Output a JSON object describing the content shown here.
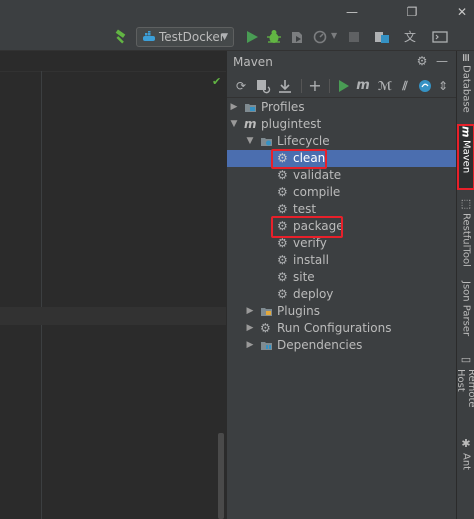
{
  "window": {
    "minimize": "—",
    "restore": "❐",
    "close": "✕"
  },
  "toolbar": {
    "run_config": "TestDocker"
  },
  "maven_panel": {
    "title": "Maven"
  },
  "tree": {
    "profiles": "Profiles",
    "project": "plugintest",
    "lifecycle": "Lifecycle",
    "phases": [
      "clean",
      "validate",
      "compile",
      "test",
      "package",
      "verify",
      "install",
      "site",
      "deploy"
    ],
    "plugins": "Plugins",
    "run_configurations": "Run Configurations",
    "dependencies": "Dependencies",
    "selected": "clean",
    "highlighted": [
      "clean",
      "package"
    ]
  },
  "right_tabs": {
    "database": "Database",
    "maven": "Maven",
    "restful": "RestfulTool",
    "json_parser": "Json Parser",
    "remote_host": "Remote Host",
    "ant": "Ant"
  },
  "colors": {
    "selection": "#4b6eaf",
    "highlight_box": "#e8202a",
    "run_green": "#499c54"
  },
  "icons": {
    "hammer": "hammer-icon",
    "run": "run-icon",
    "debug": "debug-icon",
    "stop": "stop-icon",
    "gear": "gear-icon"
  }
}
